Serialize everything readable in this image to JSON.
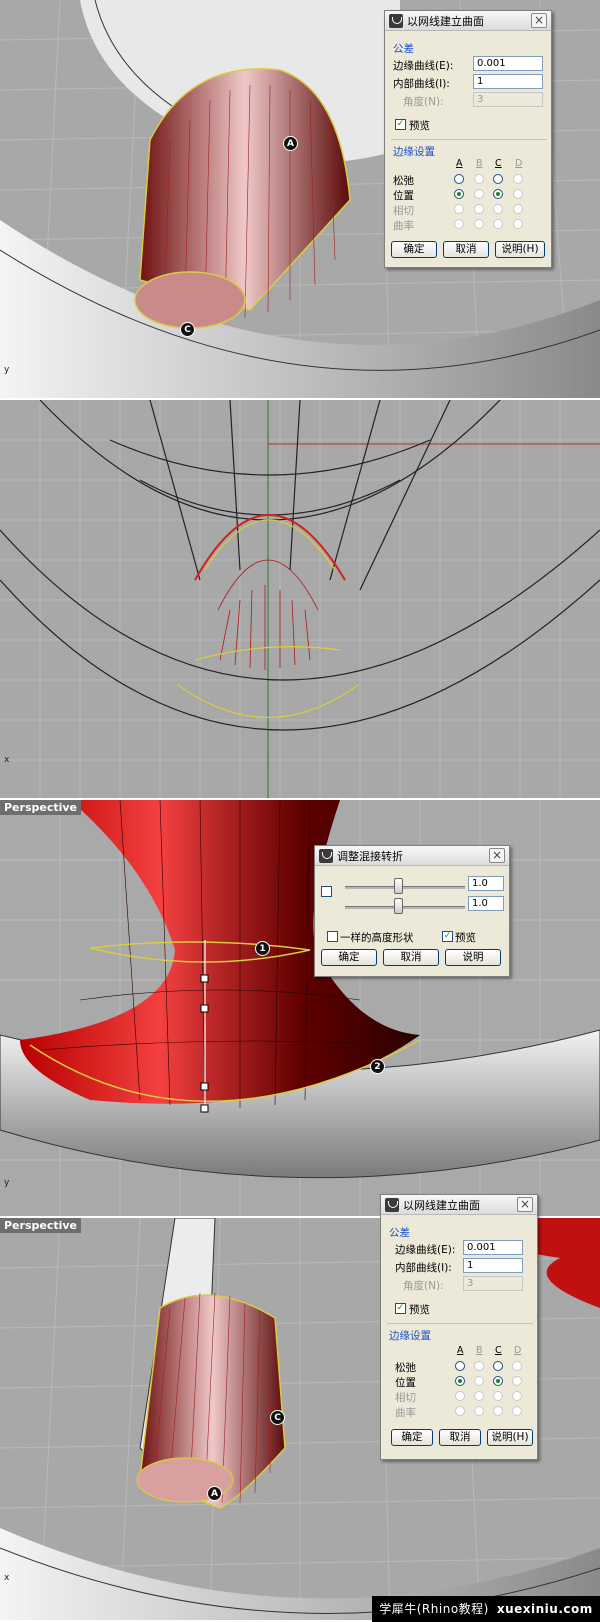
{
  "viewport": {
    "label": "Perspective",
    "axis_y": "y",
    "axis_x": "x"
  },
  "network_dialog": {
    "title": "以网线建立曲面",
    "tolerance_group": "公差",
    "edge_curves_label": "边缘曲线(E):",
    "edge_curves_value": "0.001",
    "interior_curves_label": "内部曲线(I):",
    "interior_curves_value": "1",
    "angle_label": "角度(N):",
    "angle_value": "3",
    "preview_label": "预览",
    "edge_group": "边缘设置",
    "columns": [
      "A",
      "B",
      "C",
      "D"
    ],
    "rows": [
      "松弛",
      "位置",
      "相切",
      "曲率"
    ],
    "ok": "确定",
    "cancel": "取消",
    "help": "说明(H)"
  },
  "blend_dialog": {
    "title": "调整混接转折",
    "value1": "1.0",
    "value2": "1.0",
    "same_height_label": "一样的高度形状",
    "preview_label": "预览",
    "ok": "确定",
    "cancel": "取消",
    "help": "说明"
  },
  "markers": {
    "a": "A",
    "c": "C",
    "one": "1",
    "two": "2"
  },
  "footer": {
    "text": "学犀牛(Rhino教程)",
    "site": "xuexiniu.com"
  }
}
